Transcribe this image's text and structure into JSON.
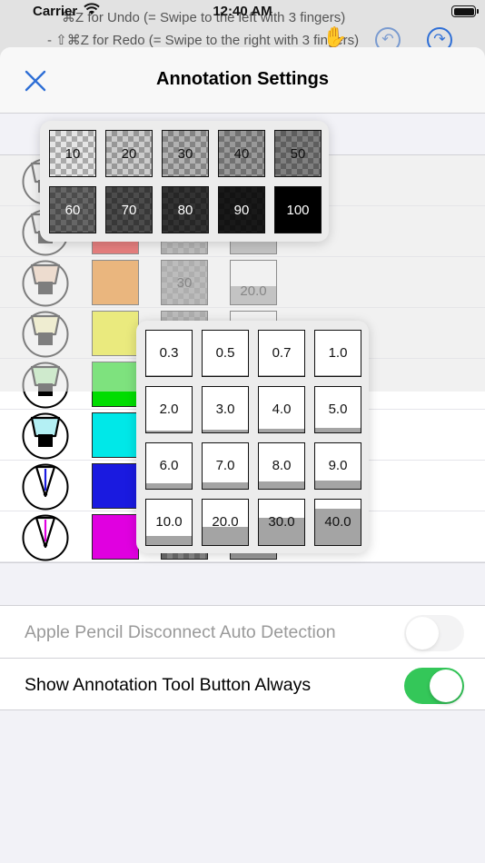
{
  "status_bar": {
    "carrier": "Carrier",
    "time": "12:40 AM"
  },
  "background_app": {
    "line1": "⌘Z for Undo (= Swipe to the left with 3 fingers)",
    "line2": "-   ⇧⌘Z for Redo (= Swipe to the right with 3 fingers)"
  },
  "sheet": {
    "title": "Annotation Settings"
  },
  "tools": [
    {
      "pen": "highlighter",
      "color": "#ffffff",
      "opacity": "",
      "width": ""
    },
    {
      "pen": "highlighter",
      "color": "#e50000",
      "opacity": "",
      "width": ""
    },
    {
      "pen": "highlighter",
      "color": "#f07d00",
      "opacity": "30",
      "width": "20.0"
    },
    {
      "pen": "highlighter",
      "color": "#f0f000",
      "opacity": "",
      "width": ""
    },
    {
      "pen": "highlighter",
      "color": "#00dd00",
      "opacity": "",
      "width": ""
    },
    {
      "pen": "highlighter",
      "color": "#00e8e8",
      "opacity": "",
      "width": ""
    },
    {
      "pen": "pen",
      "color": "#1a1ae0",
      "opacity": "",
      "width": ""
    },
    {
      "pen": "pen",
      "color": "#e000e0",
      "opacity": "",
      "width": ""
    }
  ],
  "tool_row_tints": [
    "#ffffff",
    "#ffffff",
    "#f6d0b4",
    "#fbf7b8",
    "#b4f0b0",
    "#b4f0f4",
    "#ffffff",
    "#ffffff"
  ],
  "tool_row_nibs": [
    "#000000",
    "#000000",
    "#000000",
    "#000000",
    "#000000",
    "#000000",
    "#1a1ae0",
    "#e000e0"
  ],
  "opacity_popover": {
    "options": [
      "10",
      "20",
      "30",
      "40",
      "50",
      "60",
      "70",
      "80",
      "90",
      "100"
    ]
  },
  "width_popover": {
    "options": [
      "0.3",
      "0.5",
      "0.7",
      "1.0",
      "2.0",
      "3.0",
      "4.0",
      "5.0",
      "6.0",
      "7.0",
      "8.0",
      "9.0",
      "10.0",
      "20.0",
      "30.0",
      "40.0"
    ]
  },
  "toggles": [
    {
      "label": "Apple Pencil Disconnect Auto Detection",
      "on": false,
      "enabled": false
    },
    {
      "label": "Show Annotation Tool Button Always",
      "on": true,
      "enabled": true
    }
  ],
  "colors": {
    "accent": "#2f6fd6",
    "switch_on": "#34c759"
  }
}
